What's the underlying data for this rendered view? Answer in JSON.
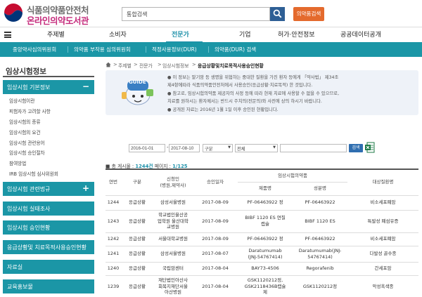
{
  "header": {
    "logo_line1": "식품의약품안전처",
    "logo_line2": "온라인의약도서관",
    "search_value": "통합검색",
    "site_search_label": "의약품검색"
  },
  "gnb": [
    "주제별",
    "소비자",
    "전문가",
    "기업",
    "허가·안전정보",
    "공공데이터공개"
  ],
  "subnav": [
    "중앙약사심의위원회",
    "의약품 부작용 심의위원회",
    "적정사용정보(DUR)",
    "의약품(DUR) 검색"
  ],
  "lnb": {
    "title": "임상시험정보",
    "section1": "임상시험 기본정보",
    "section1_sign": "−",
    "sub_items": [
      "임상시험이란",
      "피험자가 고려할 사항",
      "임상시험의 종류",
      "임상시험의 요건",
      "임상시험 관련용어",
      "임상시험 승인절차",
      "참여방법",
      "IRB 임상시험 심사위원회"
    ],
    "section2": "임상시험 관련법규",
    "section2_sign": "+",
    "section3": "임상시험 실태조사",
    "section4": "임상시험 승인현황",
    "section5": "응급상황및 치료목적사용승인현황",
    "section6": "자료실",
    "section7": "교육홍보물"
  },
  "breadcrumb": {
    "items": [
      "주제별",
      "전문가",
      "임상시험정보"
    ],
    "current": "응급상황및치료목적사용승인현황"
  },
  "notice": {
    "badge": "GUIDE",
    "lines": [
      "● 이 정보는 말기암 등 생명을 위협하는 중대한 질환을 가진 환자 등에게 「약사법」 제34조",
      "제4항에따라 식품의약품안전처에서 사용승인(응급상황·치료목적) 한 것입니다.",
      "● 참고로, 임상시험의약품 제공자의 사정 등에 따라 현재 치료에 사용할 수 없을 수 있으므로,",
      "치료를 원하시는 환자께서는 반드시 주치의(전문의)와 사전에 상의 하시기 바랍니다.",
      "● 공개된 자료는 2016년 1월 1일 이후 승인된 현황입니다."
    ]
  },
  "filters": {
    "date_from": "2016-01-01",
    "date_to": "2017-08-10",
    "select1": "구분",
    "select2": "전체",
    "keyword": "",
    "search_label": "검색"
  },
  "count": {
    "label_total": "총 게시물 :",
    "total": "1244건",
    "label_page": "페이지 :",
    "page": "1/125"
  },
  "table": {
    "headers": {
      "no": "연번",
      "type": "구분",
      "org": "신청인\n(병원,제약사)",
      "date": "승인일자",
      "drug_group": "임상시험의약품",
      "product": "제품명",
      "ingredient": "성분명",
      "disease": "대상질환명"
    },
    "rows": [
      {
        "no": "1244",
        "type": "응급상황",
        "org": "삼성서울병원",
        "date": "2017-08-09",
        "product": "PF-06463922 정",
        "ingredient": "PF-06463922",
        "disease": "비소세포폐암"
      },
      {
        "no": "1243",
        "type": "응급상황",
        "org": "학교법인울산공\n업학원 울산대학\n교병원",
        "date": "2017-08-09",
        "product": "BIBF 1120 ES 연질\n캡슐",
        "ingredient": "BIBF 1120 ES",
        "disease": "특발성 폐섬유증"
      },
      {
        "no": "1242",
        "type": "응급상황",
        "org": "서울대학교병원",
        "date": "2017-08-09",
        "product": "PF-06463922 정",
        "ingredient": "PF-06463922",
        "disease": "비소세포폐암"
      },
      {
        "no": "1241",
        "type": "응급상황",
        "org": "삼성서울병원",
        "date": "2017-08-07",
        "product": "Daratumumab\n(JNJ-54767414)",
        "ingredient": "Daratumumab(JNJ-\n54767414)",
        "disease": "다발성 골수종"
      },
      {
        "no": "1240",
        "type": "응급상황",
        "org": "국립암센터",
        "date": "2017-08-04",
        "product": "BAY73-4506",
        "ingredient": "Regorafenib",
        "disease": "간세포암"
      },
      {
        "no": "1239",
        "type": "응급상황",
        "org": "재단법인아산사\n회복지재단서울\n아산병원",
        "date": "2017-08-04",
        "product": "GSK1120212정,\nGSK2118436B캡슐\n제",
        "ingredient": "GSK1120212정",
        "disease": "악성흑색종"
      }
    ]
  },
  "colors": {
    "teal": "#1b96a6",
    "navy": "#2e5f95",
    "orange": "#e46a2d",
    "magenta": "#c52b7c"
  }
}
